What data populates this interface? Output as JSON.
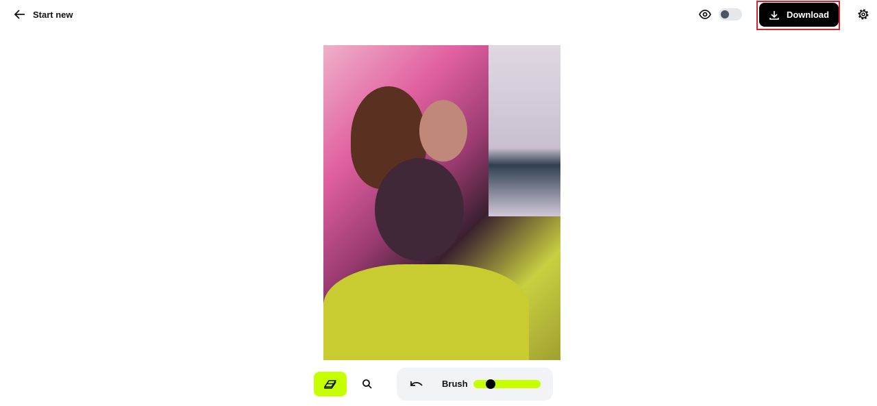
{
  "header": {
    "back_label": "Start new",
    "download_label": "Download",
    "preview_toggle_on": false
  },
  "toolbar": {
    "brush_label": "Brush",
    "brush_size_fraction": 0.25,
    "active_tool": "eraser",
    "accent_color": "#c6ff00"
  },
  "icons": [
    "arrow-left-icon",
    "eye-icon",
    "download-icon",
    "gear-icon",
    "eraser-icon",
    "search-icon",
    "undo-icon"
  ]
}
